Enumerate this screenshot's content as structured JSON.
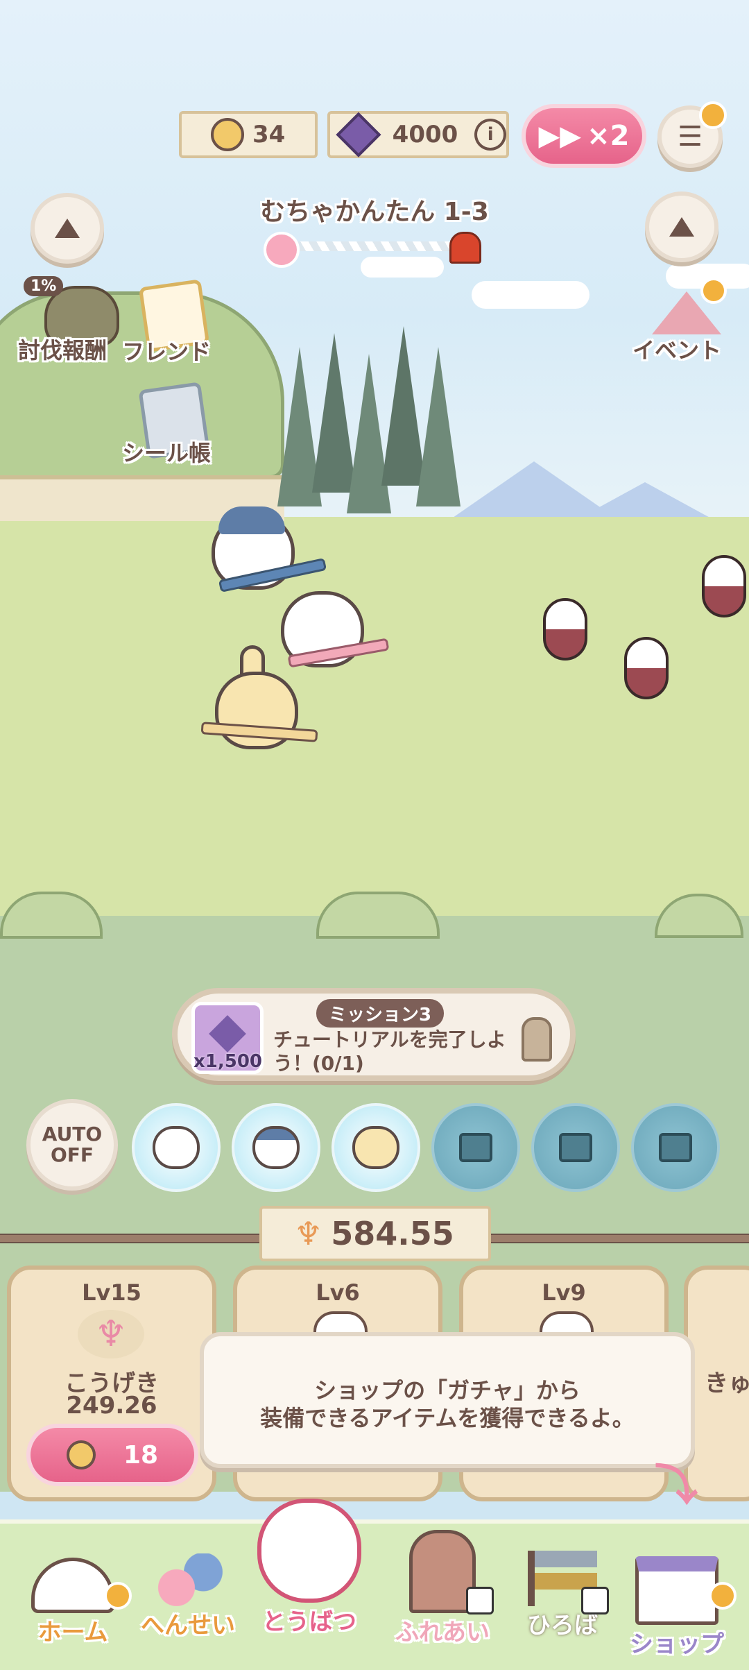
{
  "topbar": {
    "coins": "34",
    "gems": "4000",
    "speed_label": "×2"
  },
  "stage": {
    "name": "むちゃかんたん 1-3"
  },
  "left_menu": {
    "reward_percent": "1%",
    "reward_label": "討伐報酬",
    "friend_label": "フレンド",
    "sticker_label": "シール帳"
  },
  "right_menu": {
    "event_label": "イベント"
  },
  "mission": {
    "tag": "ミッション3",
    "text": "チュートリアルを完了しよう！(0/1)",
    "reward_count": "x1,500"
  },
  "auto": {
    "line1": "AUTO",
    "line2": "OFF"
  },
  "power": {
    "value": "584.55"
  },
  "cards": [
    {
      "level": "Lv15",
      "stat_name": "こうげき",
      "stat_value": "249.26",
      "cost": "18"
    },
    {
      "level": "Lv6"
    },
    {
      "level": "Lv9"
    },
    {
      "partial_label": "きゅ"
    }
  ],
  "tooltip": {
    "line1": "ショップの「ガチャ」から",
    "line2": "装備できるアイテムを獲得できるよ。"
  },
  "nav": [
    {
      "label": "ホーム"
    },
    {
      "label": "へんせい"
    },
    {
      "label": "とうばつ"
    },
    {
      "label": "ふれあい"
    },
    {
      "label": "ひろば"
    },
    {
      "label": "ショップ"
    }
  ],
  "colors": {
    "accent_pink": "#e6638a",
    "plank": "#f5ecd8",
    "text_brown": "#6b5148"
  }
}
